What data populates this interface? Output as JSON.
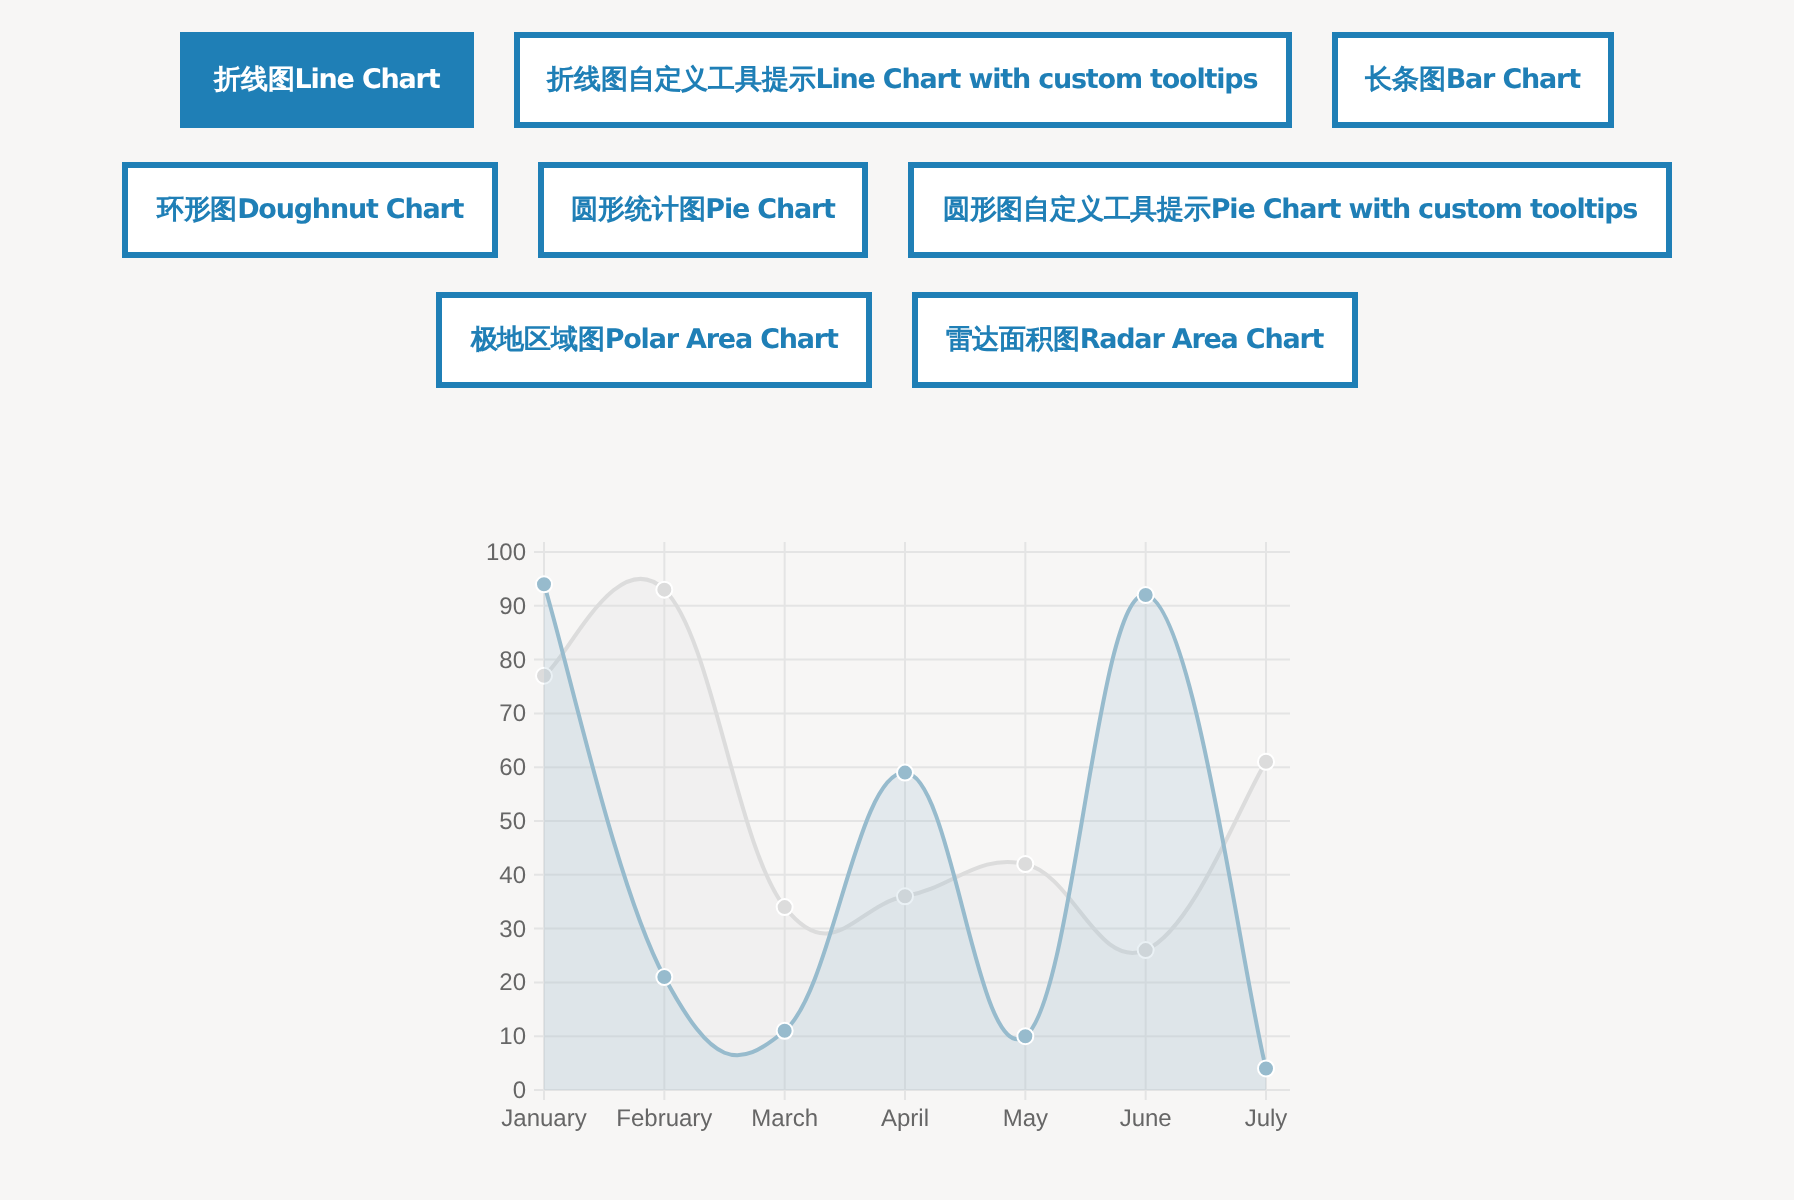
{
  "chart_buttons": [
    {
      "label": "折线图Line Chart",
      "selected": true
    },
    {
      "label": "折线图自定义工具提示Line Chart with custom tooltips",
      "selected": false
    },
    {
      "label": "长条图Bar Chart",
      "selected": false
    },
    {
      "label": "环形图Doughnut Chart",
      "selected": false
    },
    {
      "label": "圆形统计图Pie Chart",
      "selected": false
    },
    {
      "label": "圆形图自定义工具提示Pie Chart with custom tooltips",
      "selected": false
    },
    {
      "label": "极地区域图Polar Area Chart",
      "selected": false
    },
    {
      "label": "雷达面积图Radar Area Chart",
      "selected": false
    }
  ],
  "chart_data": {
    "type": "area",
    "grid": true,
    "categories": [
      "January",
      "February",
      "March",
      "April",
      "May",
      "June",
      "July"
    ],
    "series": [
      {
        "color": "#dcdcdc",
        "values": [
          77,
          93,
          34,
          36,
          42,
          26,
          61
        ]
      },
      {
        "color": "#97bbcd",
        "values": [
          94,
          21,
          11,
          59,
          10,
          92,
          4
        ]
      }
    ],
    "ylim": [
      0,
      100
    ],
    "yticks": [
      0,
      10,
      20,
      30,
      40,
      50,
      60,
      70,
      80,
      90,
      100
    ]
  }
}
